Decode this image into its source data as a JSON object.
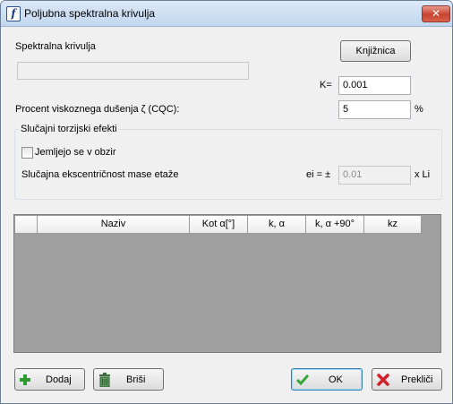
{
  "window": {
    "title": "Poljubna spektralna krivulja",
    "icon": "app-logo-icon",
    "close_glyph": "✕"
  },
  "spectrum": {
    "label": "Spektralna krivulja",
    "value": "",
    "library_button": "Knjižnica"
  },
  "k": {
    "label": "K=",
    "value": "0.001"
  },
  "damping": {
    "label": "Procent viskoznega dušenja ζ (CQC):",
    "value": "5",
    "unit": "%"
  },
  "torsion": {
    "legend": "Slučajni torzijski efekti",
    "checkbox_label": "Jemljejo se v obzir",
    "checked": false,
    "ecc_label": "Slučajna ekscentričnost mase etaže",
    "ei_label": "ei = ±",
    "ei_value": "0.01",
    "ei_suffix": "x Li"
  },
  "table": {
    "columns": [
      "",
      "Naziv",
      "Kot α[°]",
      "k, α",
      "k, α +90°",
      "kz"
    ]
  },
  "buttons": {
    "add": "Dodaj",
    "delete": "Briši",
    "ok": "OK",
    "cancel": "Prekliči"
  },
  "colors": {
    "title_bar": "#c2d7ef",
    "grid_bg": "#a0a0a0",
    "add_icon": "#2e9b2e",
    "ok_icon": "#3aa53a",
    "cancel_icon": "#d0202a"
  }
}
